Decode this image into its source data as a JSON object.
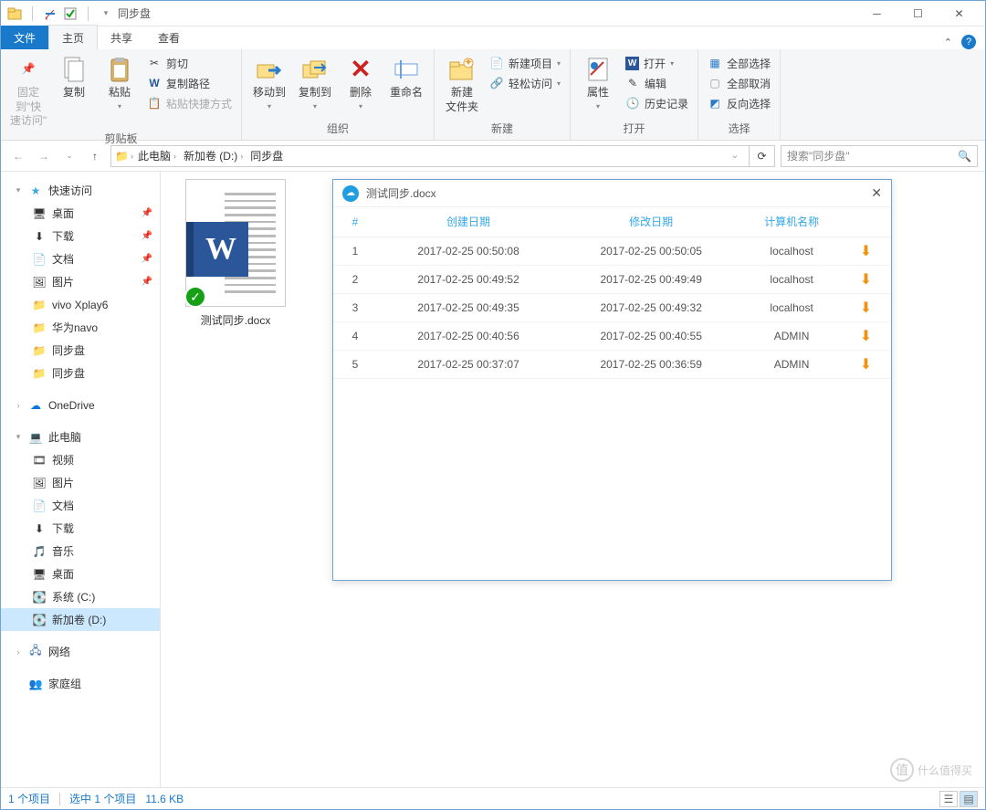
{
  "window": {
    "title": "同步盘"
  },
  "tabs": {
    "file": "文件",
    "home": "主页",
    "share": "共享",
    "view": "查看"
  },
  "ribbon": {
    "clipboard": {
      "pin": "固定到\"快\n速访问\"",
      "copy": "复制",
      "paste": "粘贴",
      "cut": "剪切",
      "copypath": "复制路径",
      "pasteshortcut": "粘贴快捷方式",
      "label": "剪贴板"
    },
    "organize": {
      "moveto": "移动到",
      "copyto": "复制到",
      "delete": "删除",
      "rename": "重命名",
      "label": "组织"
    },
    "new": {
      "newfolder": "新建\n文件夹",
      "newitem": "新建项目",
      "easyaccess": "轻松访问",
      "label": "新建"
    },
    "open": {
      "properties": "属性",
      "open": "打开",
      "edit": "编辑",
      "history": "历史记录",
      "label": "打开"
    },
    "select": {
      "selectall": "全部选择",
      "selectnone": "全部取消",
      "invert": "反向选择",
      "label": "选择"
    }
  },
  "breadcrumb": {
    "root": "此电脑",
    "vol": "新加卷 (D:)",
    "folder": "同步盘",
    "refresh_dd": "⌄"
  },
  "search": {
    "placeholder": "搜索\"同步盘\""
  },
  "tree": {
    "quick": "快速访问",
    "qitems": [
      "桌面",
      "下载",
      "文档",
      "图片",
      "vivo Xplay6",
      "华为navo",
      "同步盘",
      "同步盘"
    ],
    "onedrive": "OneDrive",
    "thispc": "此电脑",
    "pcitems": [
      "视频",
      "图片",
      "文档",
      "下载",
      "音乐",
      "桌面",
      "系统 (C:)",
      "新加卷 (D:)"
    ],
    "network": "网络",
    "homegroup": "家庭组"
  },
  "file": {
    "name": "测试同步.docx"
  },
  "panel": {
    "title": "测试同步.docx",
    "headers": {
      "num": "#",
      "created": "创建日期",
      "modified": "修改日期",
      "computer": "计算机名称"
    },
    "rows": [
      {
        "n": "1",
        "c": "2017-02-25 00:50:08",
        "m": "2017-02-25 00:50:05",
        "pc": "localhost"
      },
      {
        "n": "2",
        "c": "2017-02-25 00:49:52",
        "m": "2017-02-25 00:49:49",
        "pc": "localhost"
      },
      {
        "n": "3",
        "c": "2017-02-25 00:49:35",
        "m": "2017-02-25 00:49:32",
        "pc": "localhost"
      },
      {
        "n": "4",
        "c": "2017-02-25 00:40:56",
        "m": "2017-02-25 00:40:55",
        "pc": "ADMIN"
      },
      {
        "n": "5",
        "c": "2017-02-25 00:37:07",
        "m": "2017-02-25 00:36:59",
        "pc": "ADMIN"
      }
    ]
  },
  "status": {
    "items": "1 个项目",
    "selected": "选中 1 个项目",
    "size": "11.6 KB"
  },
  "watermark": "什么值得买"
}
